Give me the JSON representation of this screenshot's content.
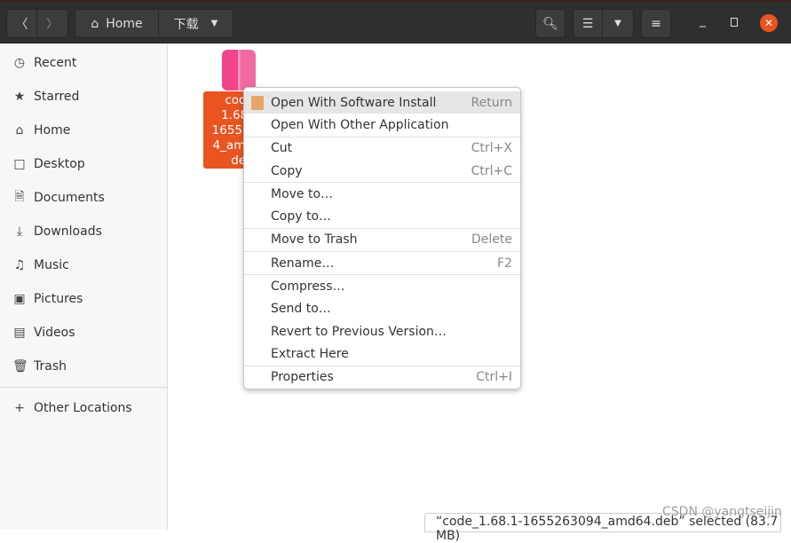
{
  "header": {
    "path": [
      "Home",
      "下载"
    ],
    "accent": "#e95420"
  },
  "sidebar": {
    "items": [
      {
        "label": "Recent",
        "icon": "clock-icon"
      },
      {
        "label": "Starred",
        "icon": "star-icon"
      },
      {
        "label": "Home",
        "icon": "home-icon"
      },
      {
        "label": "Desktop",
        "icon": "desktop-icon"
      },
      {
        "label": "Documents",
        "icon": "document-icon"
      },
      {
        "label": "Downloads",
        "icon": "download-icon"
      },
      {
        "label": "Music",
        "icon": "music-icon"
      },
      {
        "label": "Pictures",
        "icon": "picture-icon"
      },
      {
        "label": "Videos",
        "icon": "video-icon"
      },
      {
        "label": "Trash",
        "icon": "trash-icon"
      }
    ],
    "other": "Other Locations"
  },
  "file": {
    "label_lines": [
      "code_",
      "1.68.1-",
      "16552630",
      "4_amd64.",
      "deb"
    ]
  },
  "menu": [
    [
      {
        "label": "Open With Software Install",
        "accel": "Return"
      },
      {
        "label": "Open With Other Application",
        "accel": ""
      }
    ],
    [
      {
        "label": "Cut",
        "accel": "Ctrl+X"
      },
      {
        "label": "Copy",
        "accel": "Ctrl+C"
      }
    ],
    [
      {
        "label": "Move to…",
        "accel": ""
      },
      {
        "label": "Copy to…",
        "accel": ""
      }
    ],
    [
      {
        "label": "Move to Trash",
        "accel": "Delete"
      }
    ],
    [
      {
        "label": "Rename…",
        "accel": "F2"
      }
    ],
    [
      {
        "label": "Compress…",
        "accel": ""
      },
      {
        "label": "Send to…",
        "accel": ""
      },
      {
        "label": "Revert to Previous Version…",
        "accel": ""
      },
      {
        "label": "Extract Here",
        "accel": ""
      }
    ],
    [
      {
        "label": "Properties",
        "accel": "Ctrl+I"
      }
    ]
  ],
  "status": "“code_1.68.1-1655263094_amd64.deb” selected (83.7 MB)",
  "watermark": "CSDN @yangtseijin"
}
